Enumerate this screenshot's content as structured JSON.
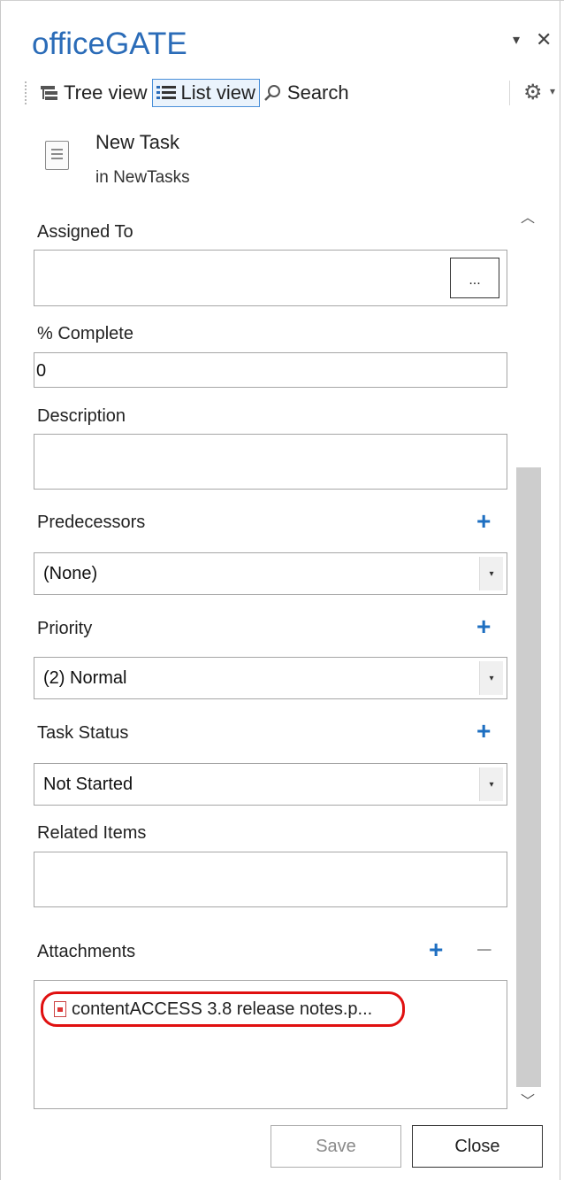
{
  "app": {
    "title": "officeGATE"
  },
  "window_controls": {
    "pin_icon": "▾",
    "close_icon": "✕"
  },
  "toolbar": {
    "tree_view": "Tree view",
    "list_view": "List view",
    "search": "Search"
  },
  "item": {
    "title": "New Task",
    "location": "in NewTasks"
  },
  "form": {
    "assigned_to": {
      "label": "Assigned To",
      "value": "",
      "browse_label": "..."
    },
    "percent_complete": {
      "label": "% Complete",
      "value": "0"
    },
    "description": {
      "label": "Description",
      "value": ""
    },
    "predecessors": {
      "label": "Predecessors",
      "value": "(None)"
    },
    "priority": {
      "label": "Priority",
      "value": "(2) Normal"
    },
    "task_status": {
      "label": "Task Status",
      "value": "Not Started"
    },
    "related_items": {
      "label": "Related Items",
      "value": ""
    },
    "attachments": {
      "label": "Attachments",
      "items": [
        "contentACCESS 3.8 release notes.p..."
      ]
    }
  },
  "actions": {
    "save": "Save",
    "close": "Close"
  },
  "colors": {
    "accent": "#2b6cb8",
    "plus": "#1e6fc1",
    "highlight": "#e01010"
  }
}
